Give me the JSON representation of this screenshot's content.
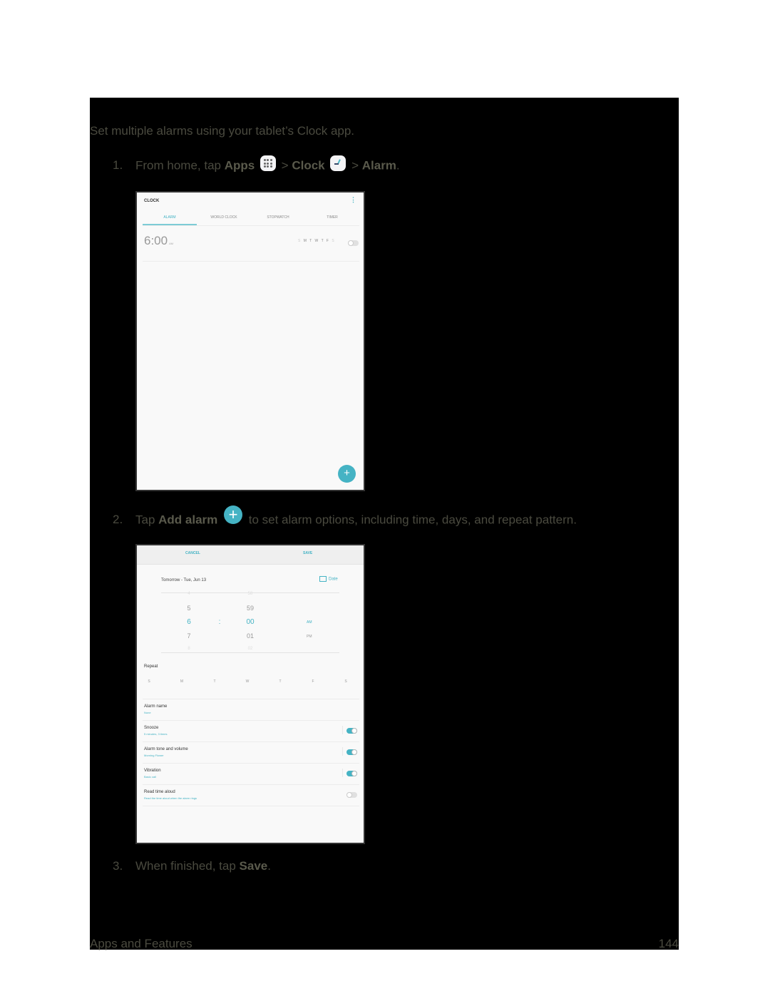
{
  "intro": "Set multiple alarms using your tablet’s Clock app.",
  "steps": [
    {
      "num": "1.",
      "pre": "From home, tap ",
      "apps": "Apps",
      "sep1": " > ",
      "clock": "Clock",
      "sep2": " > ",
      "alarm": "Alarm",
      "end": "."
    },
    {
      "num": "2.",
      "pre": "Tap ",
      "bold": "Add alarm",
      "post": " to set alarm options, including time, days, and repeat pattern."
    },
    {
      "num": "3.",
      "pre": "When finished, tap ",
      "bold": "Save",
      "end": "."
    }
  ],
  "screenshot1": {
    "title": "CLOCK",
    "menu_icon": "more-vert-icon",
    "tabs": [
      "ALARM",
      "WORLD CLOCK",
      "STOPWATCH",
      "TIMER"
    ],
    "active_tab": "ALARM",
    "alarm": {
      "time": "6:00",
      "ampm": "AM",
      "days_dim_start": "S",
      "days_active": "M T W T F",
      "days_dim_end": "S",
      "enabled": false
    },
    "fab_icon": "plus-icon"
  },
  "screenshot2": {
    "cancel": "CANCEL",
    "save": "SAVE",
    "date_text": "Tomorrow - Tue, Jun 13",
    "date_button": "Date",
    "picker": {
      "hours": [
        "4",
        "5",
        "6",
        "7",
        "8"
      ],
      "minutes": [
        "58",
        "59",
        "00",
        "01",
        "02"
      ],
      "colon": ":",
      "am": "AM",
      "pm": "PM",
      "selected_hour": "6",
      "selected_minute": "00",
      "selected_period": "AM"
    },
    "repeat_label": "Repeat",
    "days": [
      "S",
      "M",
      "T",
      "W",
      "T",
      "F",
      "S"
    ],
    "options": [
      {
        "title": "Alarm name",
        "sub": "None",
        "toggle": null
      },
      {
        "title": "Snooze",
        "sub": "5 minutes, 3 times",
        "toggle": true
      },
      {
        "title": "Alarm tone and volume",
        "sub": "Morning Flower",
        "toggle": true
      },
      {
        "title": "Vibration",
        "sub": "Basic call",
        "toggle": true
      },
      {
        "title": "Read time aloud",
        "sub": "Read the time aloud when the alarm rings",
        "toggle": false
      }
    ]
  },
  "footer": {
    "section": "Apps and Features",
    "page": "144"
  },
  "colors": {
    "accent": "#45b3c4",
    "text": "#4a4a3f",
    "page_bg": "#000000"
  }
}
